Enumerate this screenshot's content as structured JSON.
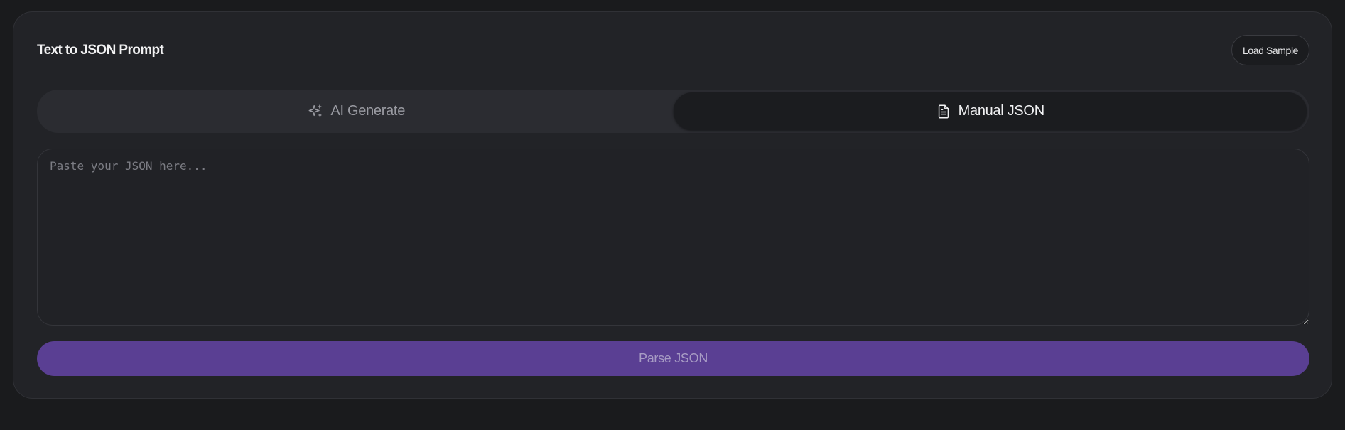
{
  "header": {
    "title": "Text to JSON Prompt",
    "load_sample_label": "Load Sample"
  },
  "tabs": [
    {
      "label": "AI Generate",
      "icon": "sparkles-icon",
      "active": false
    },
    {
      "label": "Manual JSON",
      "icon": "file-text-icon",
      "active": true
    }
  ],
  "editor": {
    "value": "",
    "placeholder": "Paste your JSON here..."
  },
  "parse_button": {
    "label": "Parse JSON"
  },
  "colors": {
    "background": "#1a1b1d",
    "card": "#222327",
    "accent": "#5a3f93"
  }
}
